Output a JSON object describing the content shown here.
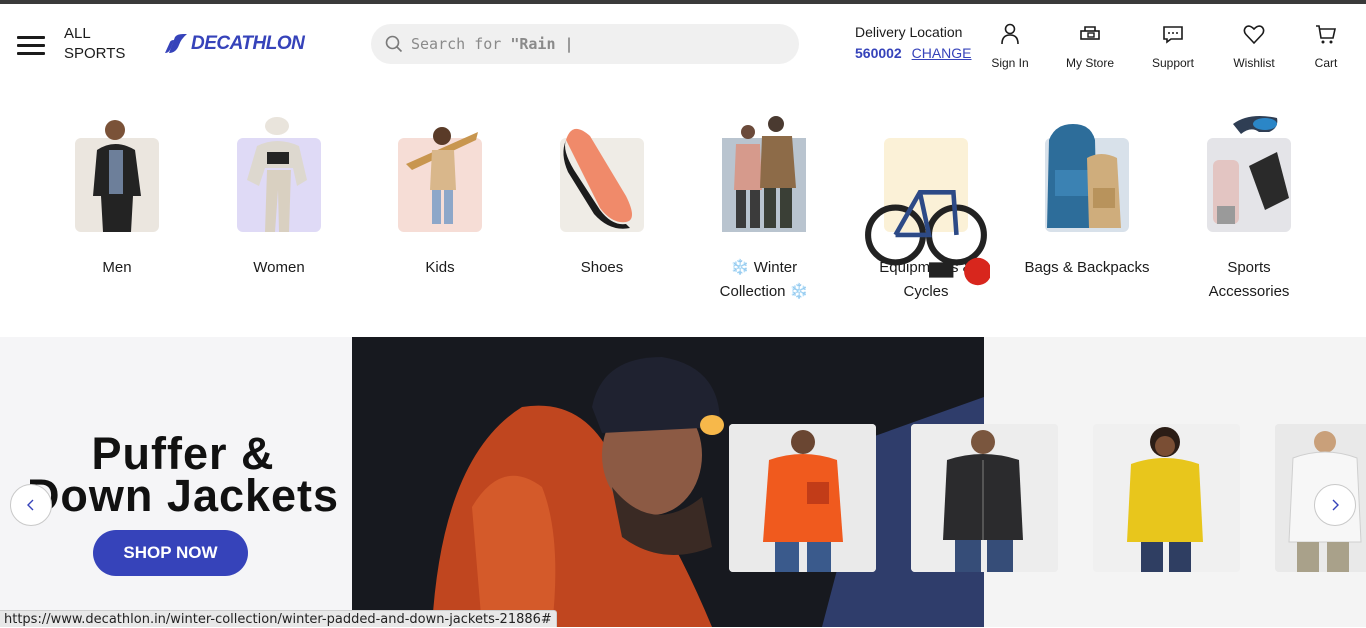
{
  "header": {
    "all_sports": "ALL\nSPORTS",
    "logo_text": "DECATHLON",
    "search": {
      "prefix": "Search for ",
      "highlight": "\"Rain |"
    },
    "delivery": {
      "title": "Delivery Location",
      "pincode": "560002",
      "change": "CHANGE"
    },
    "actions": [
      {
        "label": "Sign In",
        "icon": "user-icon"
      },
      {
        "label": "My Store",
        "icon": "store-icon"
      },
      {
        "label": "Support",
        "icon": "chat-icon"
      },
      {
        "label": "Wishlist",
        "icon": "heart-icon"
      },
      {
        "label": "Cart",
        "icon": "cart-icon"
      }
    ]
  },
  "categories": [
    {
      "label": "Men"
    },
    {
      "label": "Women"
    },
    {
      "label": "Kids"
    },
    {
      "label": "Shoes"
    },
    {
      "label": "❄️ Winter\nCollection ❄️"
    },
    {
      "label": "Equipments &\nCycles"
    },
    {
      "label": "Bags & Backpacks"
    },
    {
      "label": "Sports\nAccessories"
    }
  ],
  "hero": {
    "title_line1": "Puffer &",
    "title_line2": "Down Jackets",
    "cta": "SHOP NOW"
  },
  "status_url": "https://www.decathlon.in/winter-collection/winter-padded-and-down-jackets-21886#",
  "colors": {
    "brand": "#3643ba",
    "search_bg": "#f0f0f0"
  }
}
